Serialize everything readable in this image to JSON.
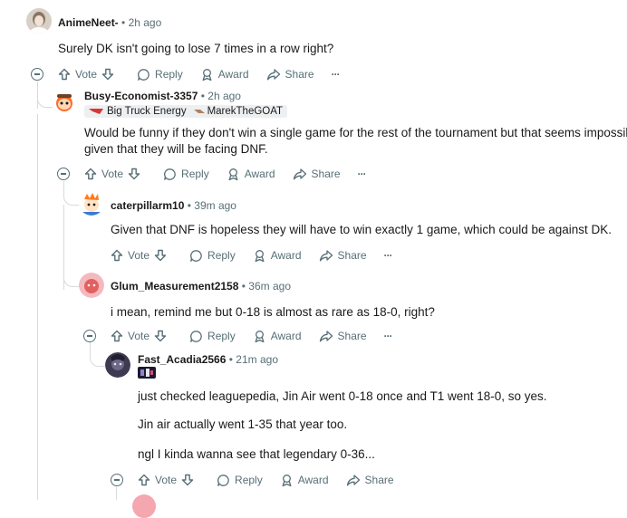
{
  "actions": {
    "vote": "Vote",
    "reply": "Reply",
    "award": "Award",
    "share": "Share",
    "more": "···"
  },
  "comments": [
    {
      "author": "AnimeNeet-",
      "sep": "•",
      "time": "2h ago",
      "lines": [
        "Surely DK isn't going to lose 7 times in a row right?"
      ]
    },
    {
      "author": "Busy-Economist-3357",
      "sep": "•",
      "time": "2h ago",
      "flair1": "Big Truck Energy",
      "flair2": "MarekTheGOAT",
      "lines": [
        "Would be funny if they don't win a single game for the rest of the tournament but that seems impossible",
        "given that they will be facing DNF."
      ]
    },
    {
      "author": "caterpillarm10",
      "sep": "•",
      "time": "39m ago",
      "lines": [
        "Given that DNF is hopeless they will have to win exactly 1 game, which could be against DK."
      ]
    },
    {
      "author": "Glum_Measurement2158",
      "sep": "•",
      "time": "36m ago",
      "lines": [
        "i mean, remind me but 0-18 is almost as rare as 18-0, right?"
      ]
    },
    {
      "author": "Fast_Acadia2566",
      "sep": "•",
      "time": "21m ago",
      "lines": [
        "just checked leaguepedia, Jin Air went 0-18 once and T1 went 18-0, so yes.",
        "Jin air actually went 1-35 that year too.",
        "ngl I kinda wanna see that legendary 0-36..."
      ]
    }
  ],
  "colors": {
    "muted": "#576f76",
    "thread": "#d7dadc",
    "text": "#1a1a1b"
  }
}
